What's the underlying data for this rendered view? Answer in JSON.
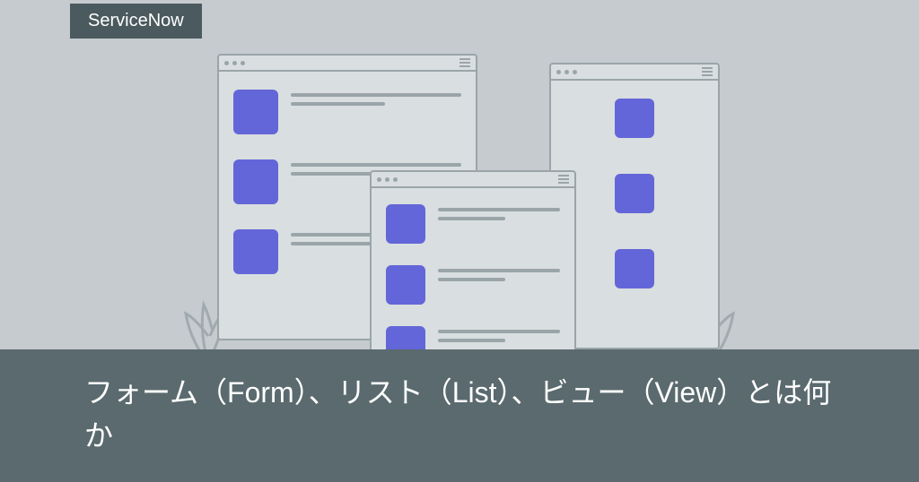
{
  "badge": {
    "label": "ServiceNow"
  },
  "title": {
    "text": "フォーム（Form）、リスト（List）、ビュー（View）とは何か"
  },
  "colors": {
    "accent": "#6366d8",
    "badge_bg": "#4a5a5e",
    "title_bg": "#5a6a6e",
    "page_bg": "#c5cbce"
  }
}
